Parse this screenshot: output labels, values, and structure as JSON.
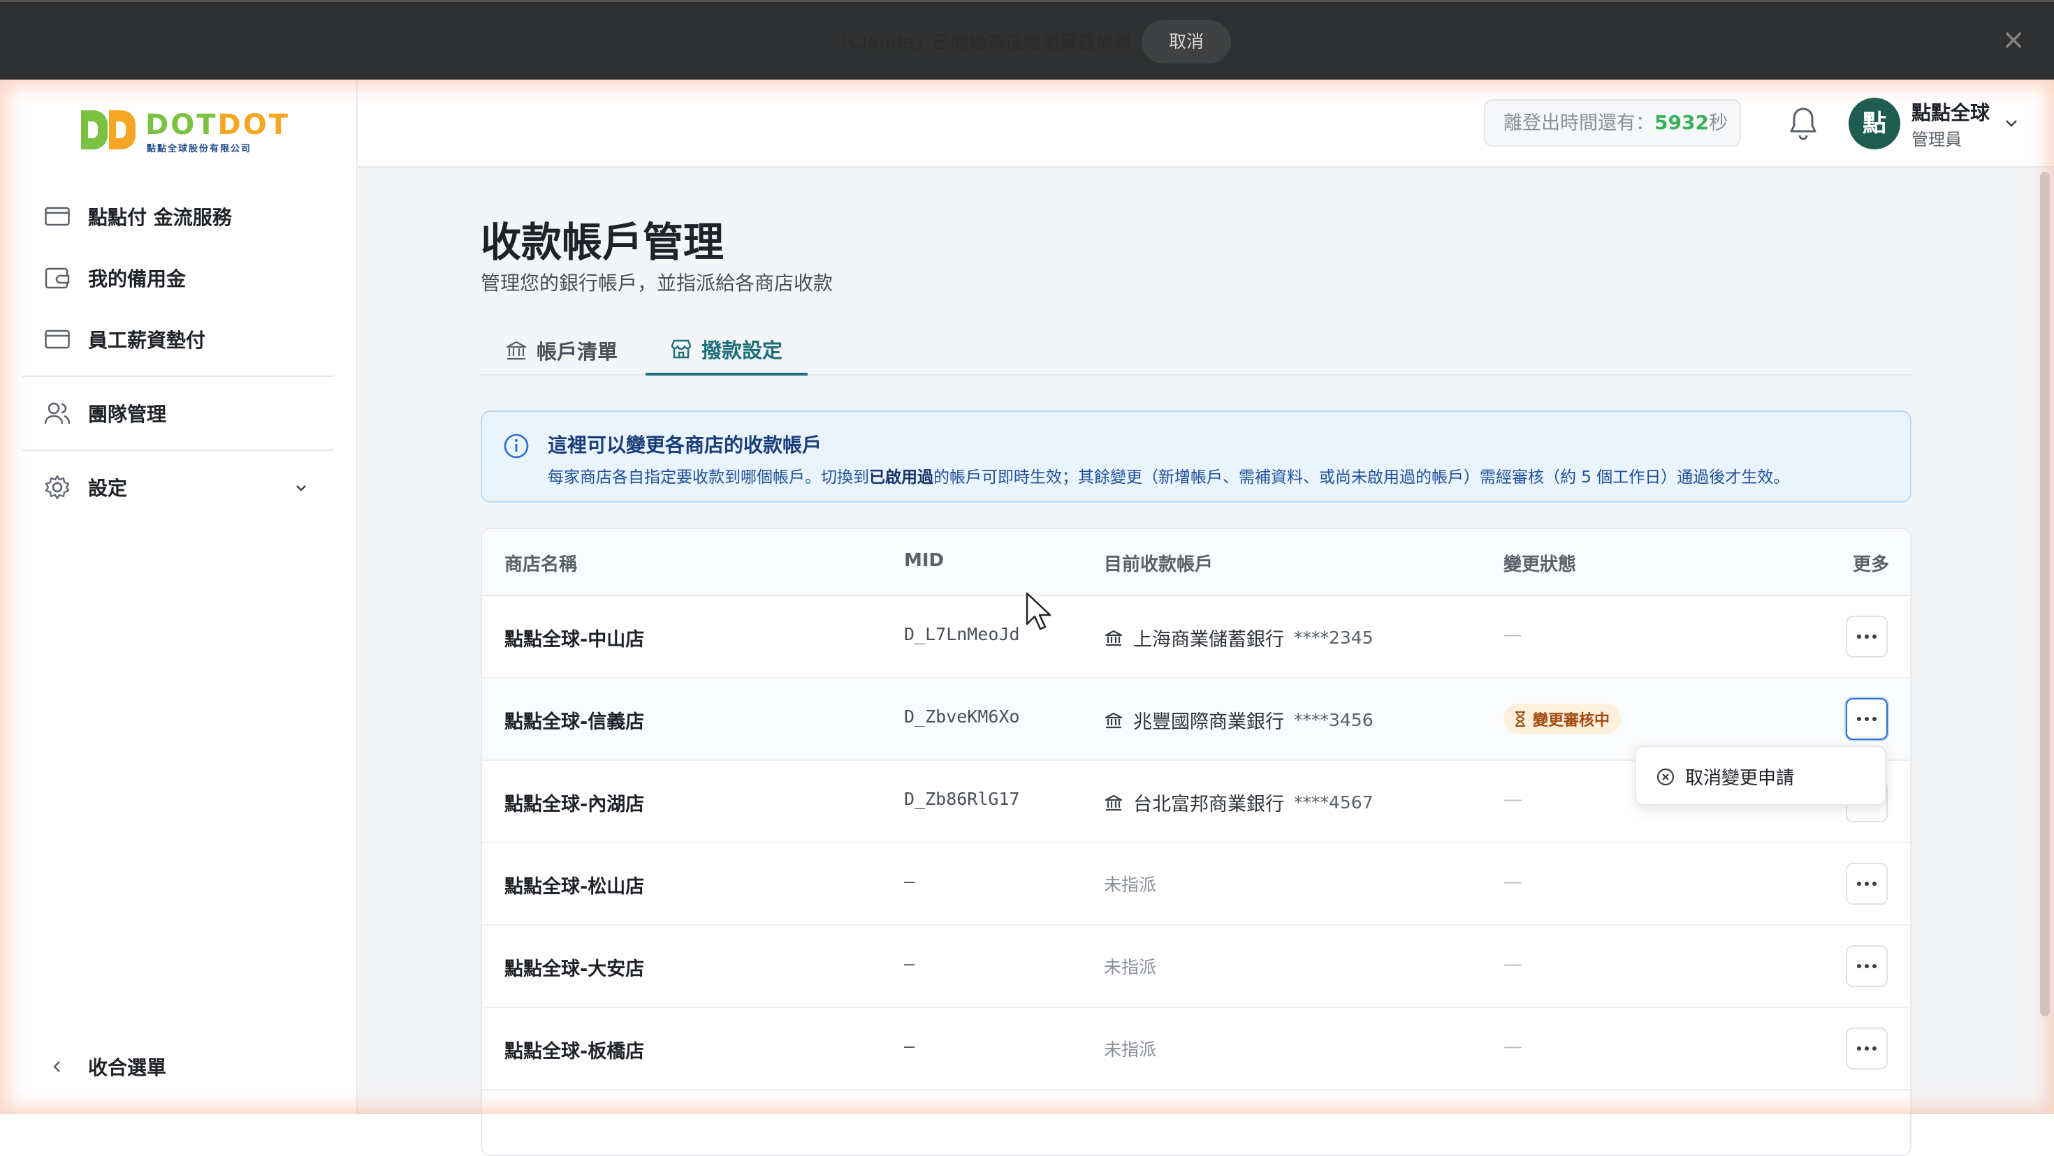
{
  "banner": {
    "message": "「Claude」已開始為這個瀏覽器偵錯",
    "cancel_label": "取消",
    "close_icon": "×"
  },
  "sidebar": {
    "logo": {
      "name_a": "DOT",
      "name_b": "DOT",
      "company": "點點全球股份有限公司"
    },
    "items": [
      {
        "label": "點點付 金流服務",
        "icon": "credit-card-icon"
      },
      {
        "label": "我的備用金",
        "icon": "wallet-icon"
      },
      {
        "label": "員工薪資墊付",
        "icon": "credit-card-icon"
      },
      {
        "label": "團隊管理",
        "icon": "users-icon"
      },
      {
        "label": "設定",
        "icon": "gear-icon"
      }
    ],
    "collapse_label": "收合選單"
  },
  "header": {
    "timer_label": "離登出時間還有：",
    "timer_value": "5932",
    "timer_unit": "秒",
    "user": {
      "avatar_char": "點",
      "name": "點點全球",
      "role": "管理員"
    }
  },
  "page": {
    "title": "收款帳戶管理",
    "subtitle": "管理您的銀行帳戶，並指派給各商店收款",
    "tabs": [
      {
        "label": "帳戶清單",
        "active": false
      },
      {
        "label": "撥款設定",
        "active": true
      }
    ]
  },
  "info": {
    "title": "這裡可以變更各商店的收款帳戶",
    "body_pre": "每家商店各自指定要收款到哪個帳戶。切換到",
    "body_bold": "已啟用過",
    "body_post": "的帳戶可即時生效；其餘變更（新增帳戶、需補資料、或尚未啟用過的帳戶）需經審核（約 5 個工作日）通過後才生效。"
  },
  "table": {
    "columns": [
      "商店名稱",
      "MID",
      "目前收款帳戶",
      "變更狀態",
      "更多"
    ],
    "rows": [
      {
        "store": "點點全球-中山店",
        "mid": "D_L7LnMeoJd",
        "bank": "上海商業儲蓄銀行",
        "mask": "****2345",
        "status": "—"
      },
      {
        "store": "點點全球-信義店",
        "mid": "D_ZbveKM6Xo",
        "bank": "兆豐國際商業銀行",
        "mask": "****3456",
        "status": "變更審核中"
      },
      {
        "store": "點點全球-內湖店",
        "mid": "D_Zb86RlG17",
        "bank": "台北富邦商業銀行",
        "mask": "****4567",
        "status": "—"
      },
      {
        "store": "點點全球-松山店",
        "mid": "—",
        "bank": "未指派",
        "mask": "",
        "status": "—"
      },
      {
        "store": "點點全球-大安店",
        "mid": "—",
        "bank": "未指派",
        "mask": "",
        "status": "—"
      },
      {
        "store": "點點全球-板橋店",
        "mid": "—",
        "bank": "未指派",
        "mask": "",
        "status": "—"
      }
    ]
  },
  "menu": {
    "cancel_change_label": "取消變更申請"
  },
  "colors": {
    "accent": "#1d6f7a",
    "brand_green": "#7cc242",
    "brand_orange": "#f5a623",
    "badge_bg": "#fdf0dc",
    "badge_text": "#a24b12"
  }
}
